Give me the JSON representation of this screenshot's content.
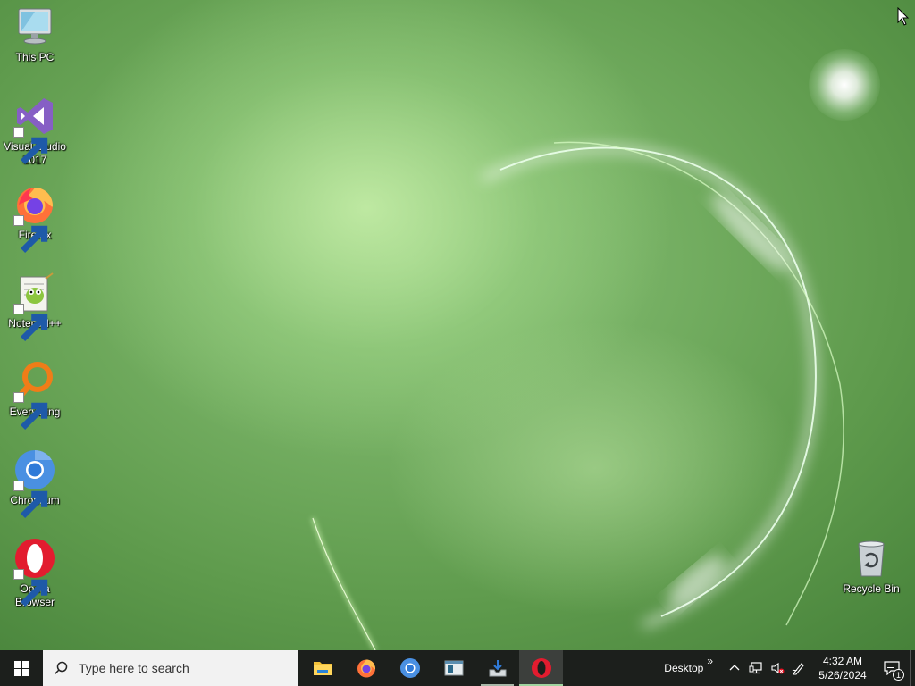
{
  "desktop": {
    "icons": [
      {
        "label": "This PC",
        "icon": "this-pc-icon"
      },
      {
        "label": "Visual Studio\n2017",
        "icon": "visual-studio-icon"
      },
      {
        "label": "Firefox",
        "icon": "firefox-icon"
      },
      {
        "label": "Notepad++",
        "icon": "notepad-plus-plus-icon"
      },
      {
        "label": "Everything",
        "icon": "everything-icon"
      },
      {
        "label": "Chromium",
        "icon": "chromium-icon"
      },
      {
        "label": "Opera\nBrowser",
        "icon": "opera-icon"
      },
      {
        "label": "Recycle Bin",
        "icon": "recycle-bin-icon"
      }
    ]
  },
  "taskbar": {
    "start_icon": "windows-start-icon",
    "search": {
      "placeholder": "Type here to search"
    },
    "apps": [
      {
        "name": "File Explorer",
        "icon": "file-explorer-icon",
        "state": "pinned"
      },
      {
        "name": "Firefox",
        "icon": "firefox-icon",
        "state": "pinned"
      },
      {
        "name": "Chromium",
        "icon": "chromium-icon",
        "state": "pinned"
      },
      {
        "name": "Terminal",
        "icon": "terminal-window-icon",
        "state": "pinned"
      },
      {
        "name": "Installer",
        "icon": "installer-icon",
        "state": "running"
      },
      {
        "name": "Opera",
        "icon": "opera-icon",
        "state": "active"
      }
    ],
    "tray": {
      "desktop_toolbar_label": "Desktop",
      "overflow_glyph": "»",
      "icons": [
        "chevron-up-icon",
        "network-icon",
        "volume-muted-icon",
        "pen-icon"
      ],
      "time": "4:32 AM",
      "date": "5/26/2024",
      "notification_count": "1"
    }
  },
  "colors": {
    "taskbar_bg": "#1c1f1c",
    "search_bg": "#f2f2f2",
    "wallpaper_mid": "#5e9a4c"
  }
}
